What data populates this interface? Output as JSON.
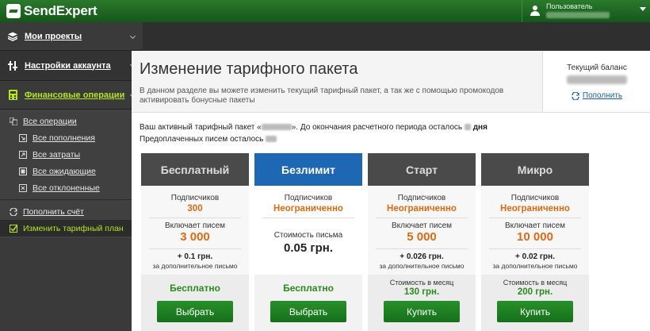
{
  "app": {
    "logo_text": "SendExpert"
  },
  "user": {
    "label": "Пользователь"
  },
  "sidebar": {
    "projects": "Мои проекты",
    "settings": "Настройки аккаунта",
    "finance": "Финансовые операции",
    "all_ops": "Все операции",
    "sub_items": [
      "Все пополнения",
      "Все затраты",
      "Все ожидающие",
      "Все отклоненные"
    ],
    "refill": "Пополнить счёт",
    "change_plan": "Изменить тарифный план"
  },
  "header": {
    "title": "Изменение тарифного пакета",
    "description": "В данном разделе вы можете изменить текущий тарифный пакет, а так же с помощью промокодов активировать бонусные пакеты"
  },
  "balance": {
    "label": "Текущий баланс",
    "refill_link": "Пополнить"
  },
  "info": {
    "part1": "Ваш активный тарифный пакет «",
    "part2": "». До окончания расчетного периода осталось",
    "days": "дня",
    "prepaid": "Предоплаченных писем осталось"
  },
  "plans": [
    {
      "name": "Бесплатный",
      "subs_label": "Подписчиков",
      "subs_value": "300",
      "inc_label": "Включает писем",
      "inc_value": "3 000",
      "extra_value": "+ 0.1 грн.",
      "extra_label": "за дополнительное письмо",
      "price_text": "Бесплатно",
      "button": "Выбрать"
    },
    {
      "name": "Безлимит",
      "subs_label": "Подписчиков",
      "subs_value": "Неограниченно",
      "cost_label": "Стоимость письма",
      "cost_value": "0.05 грн.",
      "price_text": "Бесплатно",
      "button": "Выбрать"
    },
    {
      "name": "Старт",
      "subs_label": "Подписчиков",
      "subs_value": "Неограниченно",
      "inc_label": "Включает писем",
      "inc_value": "5 000",
      "extra_value": "+ 0.026 грн.",
      "extra_label": "за дополнительное письмо",
      "month_label": "Стоимость в месяц",
      "month_value": "130 грн.",
      "button": "Купить"
    },
    {
      "name": "Микро",
      "subs_label": "Подписчиков",
      "subs_value": "Неограниченно",
      "inc_label": "Включает писем",
      "inc_value": "10 000",
      "extra_value": "+ 0.02 грн.",
      "extra_label": "за дополнительное письмо",
      "month_label": "Стоимость в месяц",
      "month_value": "200 грн.",
      "button": "Купить"
    }
  ],
  "colors": {
    "brand_green": "#1f6b21",
    "accent_orange": "#e06a14",
    "featured_blue": "#1d67b3",
    "sidebar_active": "#b5e61d"
  }
}
